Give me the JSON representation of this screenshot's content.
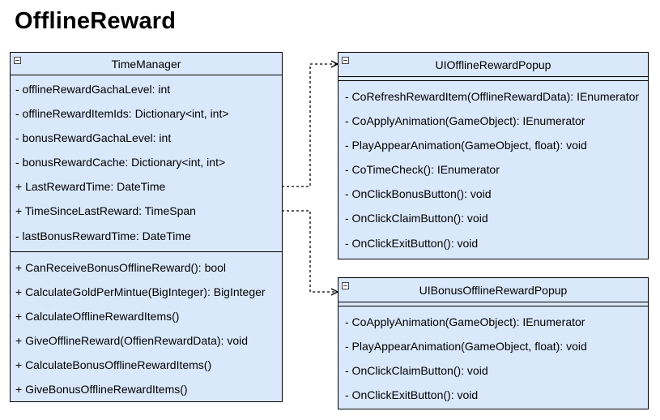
{
  "diagram": {
    "title": "OfflineReward",
    "classes": {
      "time_manager": {
        "name": "TimeManager",
        "attributes": [
          "- offlineRewardGachaLevel: int",
          "- offlineRewardItemIds: Dictionary<int, int>",
          "- bonusRewardGachaLevel: int",
          "- bonusRewardCache: Dictionary<int, int>",
          "+ LastRewardTime: DateTime",
          "+ TimeSinceLastReward: TimeSpan",
          "- lastBonusRewardTime: DateTime"
        ],
        "methods": [
          "+ CanReceiveBonusOfflineReward(): bool",
          "+ CalculateGoldPerMintue(BigInteger): BigInteger",
          "+ CalculateOfflineRewardItems()",
          "+ GiveOfflineReward(OffienRewardData): void",
          "+ CalculateBonusOfflineRewardItems()",
          "+ GiveBonusOfflineRewardItems()"
        ]
      },
      "ui_offline_reward_popup": {
        "name": "UIOfflineRewardPopup",
        "attributes": [],
        "methods": [
          "- CoRefreshRewardItem(OfflineRewardData): IEnumerator",
          "- CoApplyAnimation(GameObject): IEnumerator",
          "- PlayAppearAnimation(GameObject, float): void",
          "- CoTimeCheck(): IEnumerator",
          "- OnClickBonusButton(): void",
          "- OnClickClaimButton(): void",
          "- OnClickExitButton(): void"
        ]
      },
      "ui_bonus_offline_reward_popup": {
        "name": "UIBonusOfflineRewardPopup",
        "attributes": [],
        "methods": [
          "- CoApplyAnimation(GameObject): IEnumerator",
          "- PlayAppearAnimation(GameObject, float): void",
          "- OnClickClaimButton(): void",
          "- OnClickExitButton(): void"
        ]
      }
    },
    "colors": {
      "class_fill": "#dae8fc",
      "stroke": "#000000",
      "connector": "#000000"
    }
  }
}
